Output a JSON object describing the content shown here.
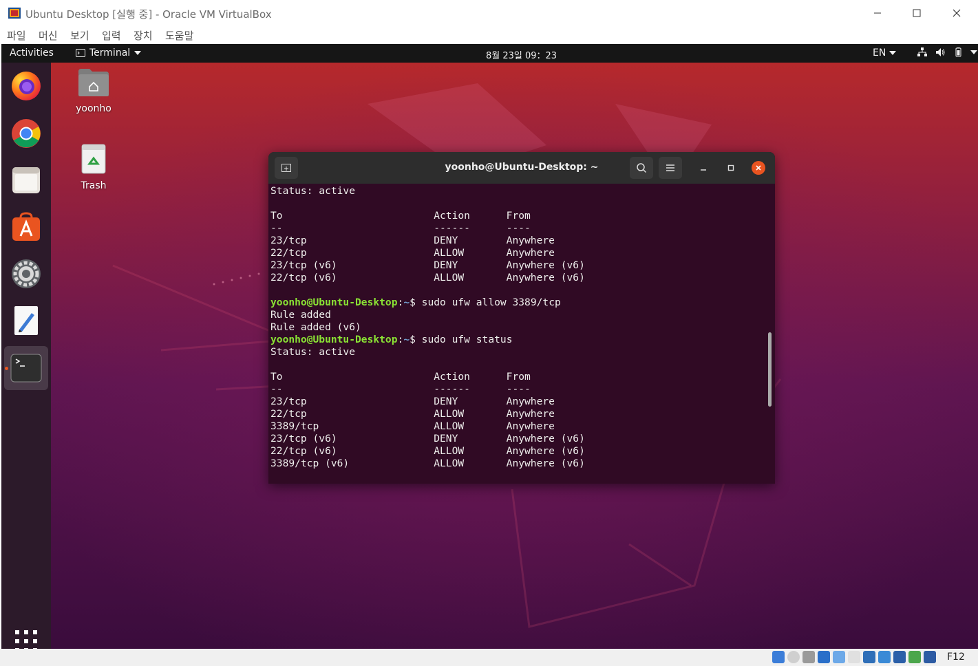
{
  "host_window": {
    "title": "Ubuntu Desktop [실행 중] - Oracle VM VirtualBox",
    "menu": [
      "파일",
      "머신",
      "보기",
      "입력",
      "장치",
      "도움말"
    ],
    "host_key": "F12",
    "status_icons": [
      "hard-disk-icon",
      "optical-drive-icon",
      "audio-icon",
      "network-icon",
      "usb-icon",
      "shared-folders-icon",
      "display-icon",
      "video-capture-icon",
      "virtualization-icon",
      "mouse-integration-icon",
      "keyboard-capture-icon"
    ]
  },
  "ubuntu": {
    "topbar": {
      "activities": "Activities",
      "app_name": "Terminal",
      "clock": "8월 23일  09：23",
      "language": "EN"
    },
    "desktop_icons": [
      {
        "label": "yoonho",
        "icon": "home-folder-icon"
      },
      {
        "label": "Trash",
        "icon": "trash-icon"
      }
    ],
    "dock": [
      "firefox-icon",
      "chrome-icon",
      "files-icon",
      "software-icon",
      "settings-icon",
      "text-editor-icon",
      "terminal-icon"
    ],
    "accent_color": "#e95420"
  },
  "terminal": {
    "title": "yoonho@Ubuntu-Desktop: ~",
    "prompt_user": "yoonho@Ubuntu-Desktop",
    "prompt_path": "~",
    "lines": [
      {
        "text": "Status: active"
      },
      {
        "text": ""
      },
      {
        "text": "To                         Action      From"
      },
      {
        "text": "--                         ------      ----"
      },
      {
        "text": "23/tcp                     DENY        Anywhere"
      },
      {
        "text": "22/tcp                     ALLOW       Anywhere"
      },
      {
        "text": "23/tcp (v6)                DENY        Anywhere (v6)"
      },
      {
        "text": "22/tcp (v6)                ALLOW       Anywhere (v6)"
      },
      {
        "text": ""
      },
      {
        "prompt": true,
        "text": "sudo ufw allow 3389/tcp"
      },
      {
        "text": "Rule added"
      },
      {
        "text": "Rule added (v6)"
      },
      {
        "prompt": true,
        "text": "sudo ufw status"
      },
      {
        "text": "Status: active"
      },
      {
        "text": ""
      },
      {
        "text": "To                         Action      From"
      },
      {
        "text": "--                         ------      ----"
      },
      {
        "text": "23/tcp                     DENY        Anywhere"
      },
      {
        "text": "22/tcp                     ALLOW       Anywhere"
      },
      {
        "text": "3389/tcp                   ALLOW       Anywhere"
      },
      {
        "text": "23/tcp (v6)                DENY        Anywhere (v6)"
      },
      {
        "text": "22/tcp (v6)                ALLOW       Anywhere (v6)"
      },
      {
        "text": "3389/tcp (v6)              ALLOW       Anywhere (v6)"
      }
    ]
  }
}
